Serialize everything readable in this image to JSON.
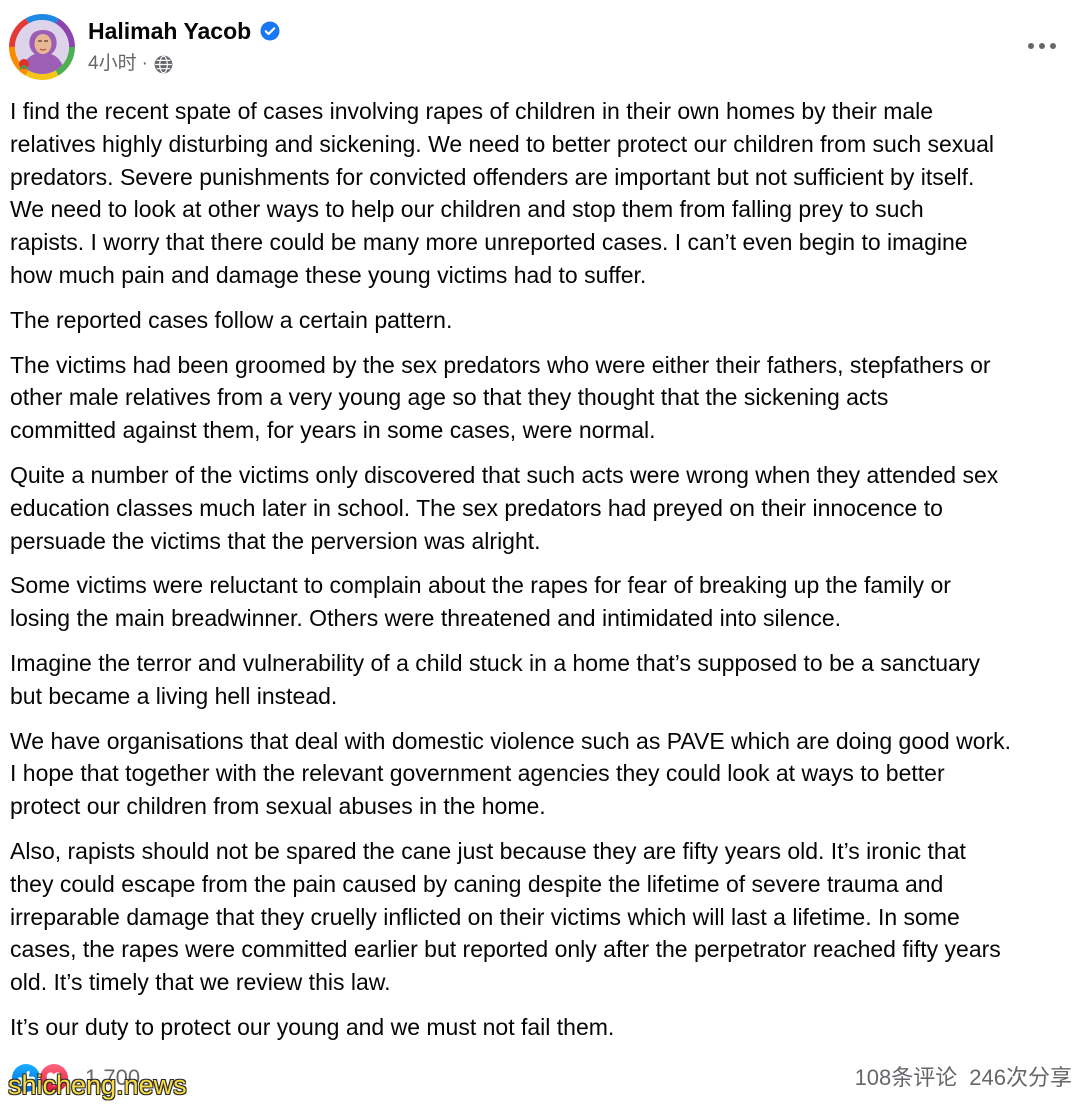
{
  "post": {
    "author_name": "Halimah Yacob",
    "verified_icon": "verified-badge-icon",
    "timestamp": "4小时",
    "meta_separator": "·",
    "privacy_icon": "globe-icon",
    "more_icon": "more-options-icon",
    "paragraphs": [
      [
        "I find the recent spate of cases involving rapes of children in their own homes by their male",
        "relatives highly disturbing and sickening. We need to better protect our children from such sexual",
        "predators. Severe punishments for convicted offenders are important but not sufficient by itself.",
        "We need to look at other ways to help our children and stop them from falling prey to such",
        "rapists. I worry that there could be many more unreported cases. I can’t even begin to imagine",
        "how much pain and damage these young victims had to suffer."
      ],
      [
        "The reported cases follow a certain pattern."
      ],
      [
        "The victims had been groomed by the sex predators who were either their fathers, stepfathers or",
        "other male relatives from a very young age so that they thought that the sickening acts",
        "committed against them, for years in some cases, were normal."
      ],
      [
        "Quite a number of the victims only discovered that such acts were wrong when they attended sex",
        "education classes much later in school. The sex predators had preyed on their innocence to",
        "persuade the victims that the perversion was alright."
      ],
      [
        "Some victims were reluctant to complain about the rapes for fear of breaking up the family or",
        "losing the main breadwinner. Others were threatened and intimidated into silence."
      ],
      [
        "Imagine the terror and vulnerability of a child stuck in a home that’s supposed to be a sanctuary",
        "but became a living hell instead."
      ],
      [
        "We have organisations that deal with domestic violence such as PAVE which are doing good work.",
        "I hope that together with the relevant government agencies they could look at ways to better",
        "protect our children from sexual abuses in the home."
      ],
      [
        "Also, rapists should not be spared the cane just because they are fifty years old. It’s ironic that",
        "they could escape from the pain caused by caning despite the lifetime of severe trauma and",
        "irreparable damage that they cruelly inflicted on their victims which will last a lifetime. In some",
        "cases, the rapes were committed earlier but reported only after the perpetrator reached fifty years",
        "old. It’s timely that we review this law."
      ],
      [
        "It’s our duty to protect our young and we must not fail them."
      ]
    ]
  },
  "footer": {
    "reaction_icons": [
      "like-icon",
      "love-icon"
    ],
    "reaction_count": "1,700",
    "comment_count": "108条评论",
    "share_count": "246次分享"
  },
  "watermark": "shicheng.news",
  "colors": {
    "text": "#050505",
    "secondary_text": "#65676b",
    "verified_blue": "#1877f2",
    "like_blue": "#1877f2",
    "love_red": "#f33e58",
    "watermark_yellow": "#f7dc45"
  }
}
